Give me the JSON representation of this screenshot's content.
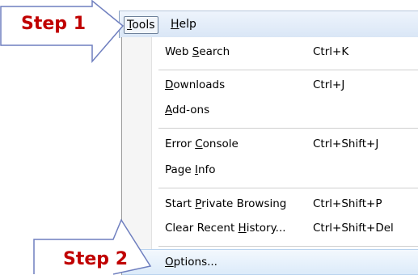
{
  "menubar": {
    "tools": {
      "pre": "",
      "acc": "T",
      "post": "ools"
    },
    "help": {
      "pre": "",
      "acc": "H",
      "post": "elp"
    }
  },
  "menu": {
    "web_search": {
      "pre": "Web ",
      "acc": "S",
      "post": "earch",
      "shortcut": "Ctrl+K"
    },
    "downloads": {
      "pre": "",
      "acc": "D",
      "post": "ownloads",
      "shortcut": "Ctrl+J"
    },
    "addons": {
      "pre": "",
      "acc": "A",
      "post": "dd-ons"
    },
    "error_console": {
      "pre": "Error ",
      "acc": "C",
      "post": "onsole",
      "shortcut": "Ctrl+Shift+J"
    },
    "page_info": {
      "pre": "Page ",
      "acc": "I",
      "post": "nfo"
    },
    "private_browsing": {
      "pre": "Start ",
      "acc": "P",
      "post": "rivate Browsing",
      "shortcut": "Ctrl+Shift+P"
    },
    "clear_history": {
      "pre": "Clear Recent ",
      "acc": "H",
      "post": "istory...",
      "shortcut": "Ctrl+Shift+Del"
    },
    "options": {
      "pre": "",
      "acc": "O",
      "post": "ptions..."
    }
  },
  "callouts": {
    "step1": "Step 1",
    "step2": "Step 2",
    "color": "#c00000",
    "border_color": "#6f7fbf"
  }
}
